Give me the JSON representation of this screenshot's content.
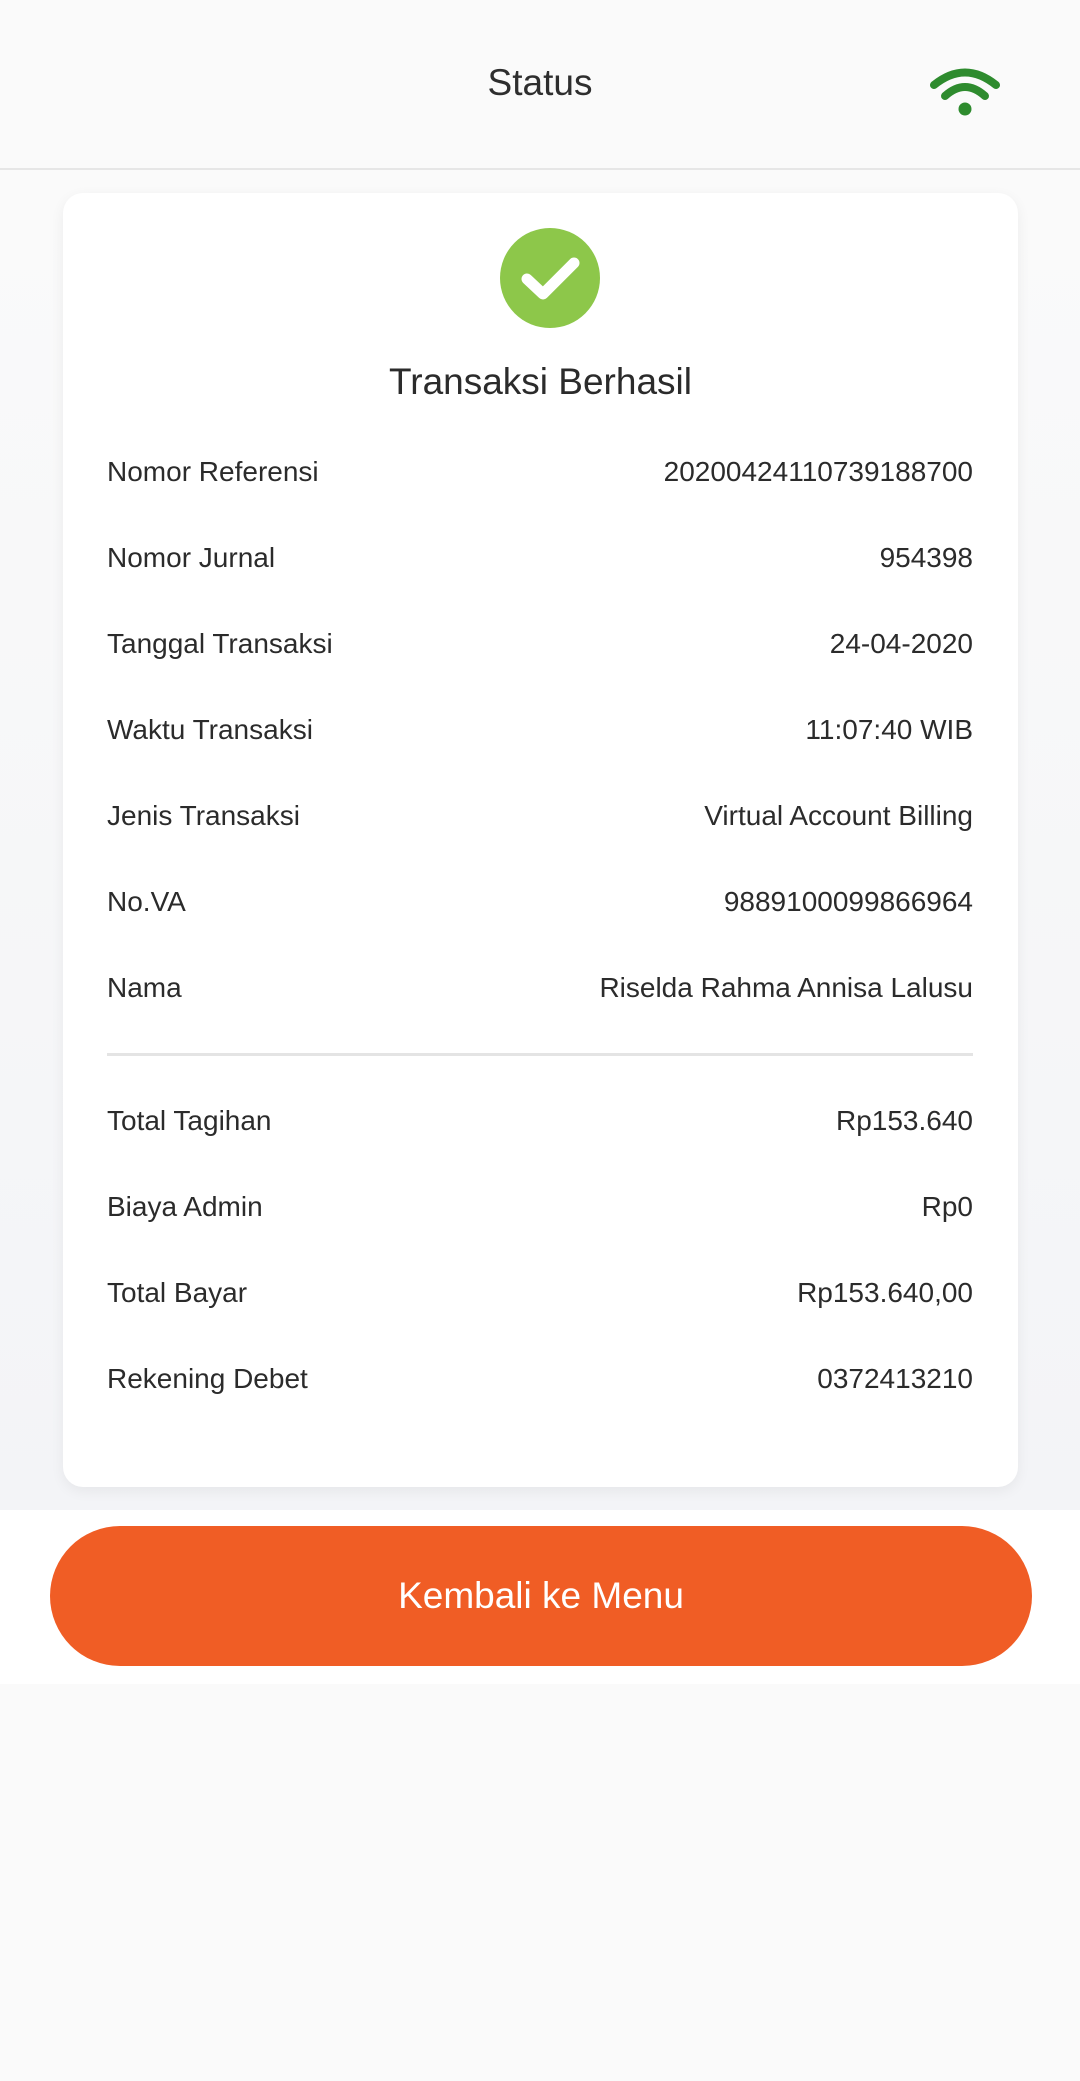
{
  "header": {
    "title": "Status",
    "wifi_icon": "wifi-icon",
    "wifi_color": "#2e8b2e"
  },
  "card": {
    "status_icon": "check-circle-icon",
    "status_color": "#8dc74a",
    "status_title": "Transaksi Berhasil",
    "details": [
      {
        "label": "Nomor Referensi",
        "value": "20200424110739188700"
      },
      {
        "label": "Nomor Jurnal",
        "value": "954398"
      },
      {
        "label": "Tanggal Transaksi",
        "value": "24-04-2020"
      },
      {
        "label": "Waktu Transaksi",
        "value": "11:07:40 WIB"
      },
      {
        "label": "Jenis Transaksi",
        "value": "Virtual Account Billing"
      },
      {
        "label": "No.VA",
        "value": "9889100099866964"
      },
      {
        "label": "Nama",
        "value": "Riselda Rahma Annisa Lalusu"
      }
    ],
    "totals": [
      {
        "label": "Total Tagihan",
        "value": "Rp153.640"
      },
      {
        "label": "Biaya Admin",
        "value": "Rp0"
      },
      {
        "label": "Total Bayar",
        "value": "Rp153.640,00"
      },
      {
        "label": "Rekening Debet",
        "value": "0372413210"
      }
    ]
  },
  "footer": {
    "back_button_label": "Kembali ke Menu",
    "button_color": "#f05d25"
  }
}
